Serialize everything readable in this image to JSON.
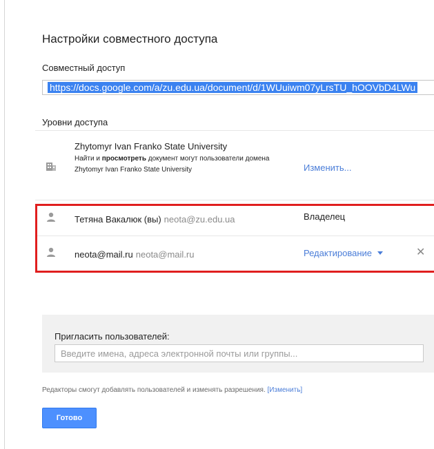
{
  "dialog": {
    "title": "Настройки совместного доступа"
  },
  "share_link": {
    "label": "Совместный доступ",
    "value": "https://docs.google.com/a/zu.edu.ua/document/d/1WUuiwm07yLrsTU_hOOVbD4LWu"
  },
  "access": {
    "label": "Уровни доступа",
    "org": {
      "name": "Zhytomyr Ivan Franko State University",
      "desc_part1": "Найти и ",
      "desc_bold": "просмотреть",
      "desc_part2": " документ могут пользователи домена Zhytomyr Ivan Franko State University",
      "change_label": "Изменить..."
    },
    "owner": {
      "name": "Тетяна Вакалюк (вы)",
      "email": "neota@zu.edu.ua",
      "role": "Владелец"
    },
    "editor": {
      "name": "neota@mail.ru",
      "email": "neota@mail.ru",
      "role": "Редактирование",
      "remove_glyph": "✕"
    }
  },
  "invite": {
    "label": "Пригласить пользователей:",
    "placeholder": "Введите имена, адреса электронной почты или группы..."
  },
  "editors_note": {
    "text": "Редакторы смогут добавлять пользователей и изменять разрешения.",
    "link": "[Изменить]"
  },
  "done_label": "Готово",
  "colors": {
    "accent": "#4d90fe",
    "link": "#4a7dd8",
    "highlight": "#e01e1e"
  }
}
